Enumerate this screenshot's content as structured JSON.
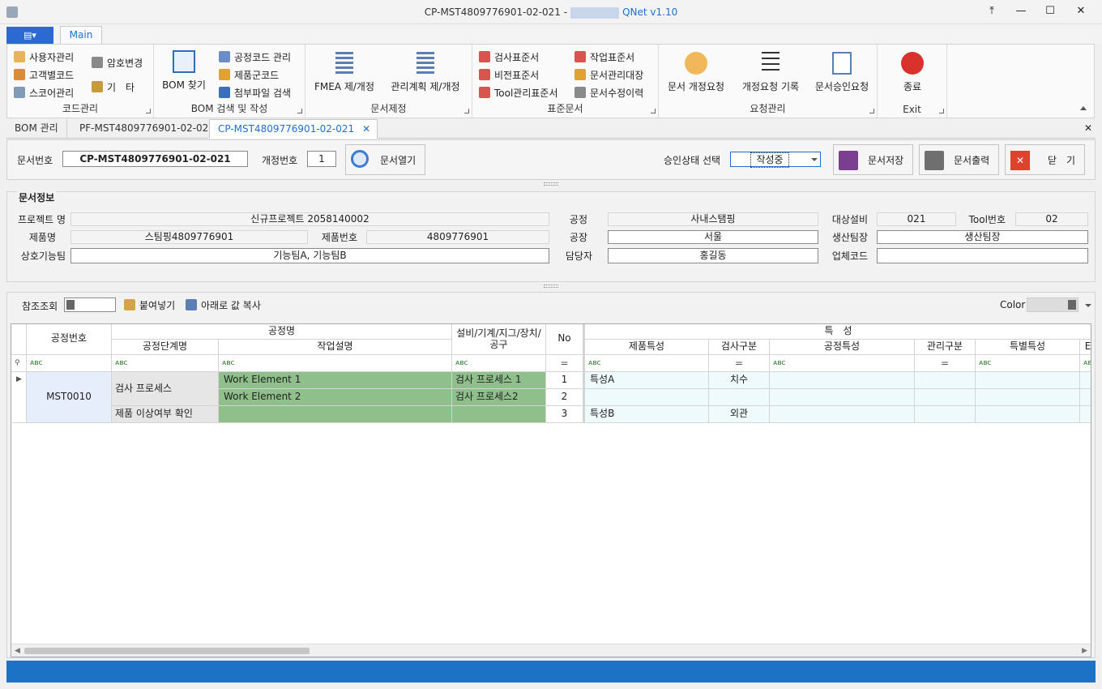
{
  "window": {
    "title": "CP-MST4809776901-02-021 -",
    "app_name": "QNet v1.10",
    "buttons": [
      "⤒",
      "—",
      "☐",
      "✕"
    ]
  },
  "ribbon": {
    "app_menu_label": "▤▾",
    "tab_main": "Main",
    "groups": {
      "code": {
        "label": "코드관리",
        "items": [
          "사용자관리",
          "고객별코드",
          "스코어관리",
          "암호변경",
          "기　타"
        ]
      },
      "bom": {
        "label": "BOM 검색 및 작성",
        "big": "BOM 찾기",
        "items": [
          "공정코드 관리",
          "제품군코드",
          "첨부파일 검색"
        ]
      },
      "doc": {
        "label": "문서제정",
        "big1": "FMEA 제/개정",
        "big2": "관리계획 제/개정"
      },
      "std": {
        "label": "표준문서",
        "items": [
          "검사표준서",
          "비전표준서",
          "Tool관리표준서",
          "작업표준서",
          "문서관리대장",
          "문서수정이력"
        ]
      },
      "req": {
        "label": "요청관리",
        "big1": "문서 개정요청",
        "big2": "개정요청 기록",
        "big3": "문서승인요청"
      },
      "exit": {
        "label": "Exit",
        "big": "종료"
      }
    }
  },
  "doc_tabs": [
    {
      "label": "BOM 관리"
    },
    {
      "label": "PF-MST4809776901-02-021"
    },
    {
      "label": "CP-MST4809776901-02-021",
      "close": "✕"
    }
  ],
  "doc_tabs_close": "✕",
  "docbar": {
    "doc_no_label": "문서번호",
    "doc_no": "CP-MST4809776901-02-021",
    "rev_label": "개정번호",
    "rev": "1",
    "open_btn": "문서열기",
    "approval_label": "승인상태 선택",
    "approval_value": "작성중",
    "save_btn": "문서저장",
    "print_btn": "문서출력",
    "close_btn": "닫　기"
  },
  "docinfo": {
    "title": "문서정보",
    "project_label": "프로젝트 명",
    "project": "신규프로젝트 2058140002",
    "process_label": "공정",
    "process": "사내스탬핑",
    "equip_label": "대상설비",
    "equip": "021",
    "tool_label": "Tool번호",
    "tool": "02",
    "product_label": "제품명",
    "product": "스팀핑4809776901",
    "product_no_label": "제품번호",
    "product_no": "4809776901",
    "plant_label": "공장",
    "plant": "서울",
    "team_label": "생산팀장",
    "team": "생산팀장",
    "func_label": "상호기능팀",
    "func": "기능팀A, 기능팀B",
    "owner_label": "담당자",
    "owner": "홍길동",
    "vendor_label": "업체코드",
    "vendor": ""
  },
  "gridtool": {
    "ref_label": "참조조회",
    "paste_btn": "붙여넣기",
    "copy_down_btn": "아래로 값 복사",
    "color_label": "Color"
  },
  "grid": {
    "headers": {
      "proc_no": "공정번호",
      "proc_name": "공정명",
      "stage": "공정단계명",
      "work_desc": "작업설명",
      "equip": "설비/기계/지그/장치/공구",
      "no": "No",
      "char": "특　성",
      "product_char": "제품특성",
      "insp_type": "검사구분",
      "proc_char": "공정특성",
      "mgmt_type": "관리구분",
      "special_char": "특별특성",
      "e": "E"
    },
    "filter_abc": "ᴀʙc",
    "filter_eq": "=",
    "rows": [
      {
        "proc_no": "MST0010",
        "stage": "검사 프로세스",
        "work": "Work Element 1",
        "equip": "검사 프로세스 1",
        "no": "1",
        "pchar": "특성A",
        "insp": "치수"
      },
      {
        "work": "Work Element 2",
        "equip": "검사 프로세스2",
        "no": "2",
        "pchar": "",
        "insp": ""
      },
      {
        "stage": "제품 이상여부 확인",
        "work": "",
        "equip": "",
        "no": "3",
        "pchar": "특성B",
        "insp": "외관"
      }
    ]
  },
  "colors": {
    "accent": "#1f6fd1",
    "status": "#1c73c6",
    "green_cell": "#8fbf8a"
  }
}
